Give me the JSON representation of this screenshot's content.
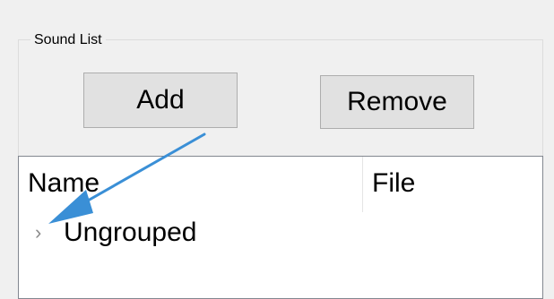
{
  "sound_list": {
    "legend": "Sound List",
    "add_label": "Add",
    "remove_label": "Remove",
    "columns": [
      "Name",
      "File"
    ],
    "rows": [
      {
        "label": "Ungrouped",
        "expand_icon": "chevron-right-icon"
      }
    ]
  },
  "annotation": {
    "icon": "annotation-arrow-icon",
    "color": "#3a8fd6"
  }
}
